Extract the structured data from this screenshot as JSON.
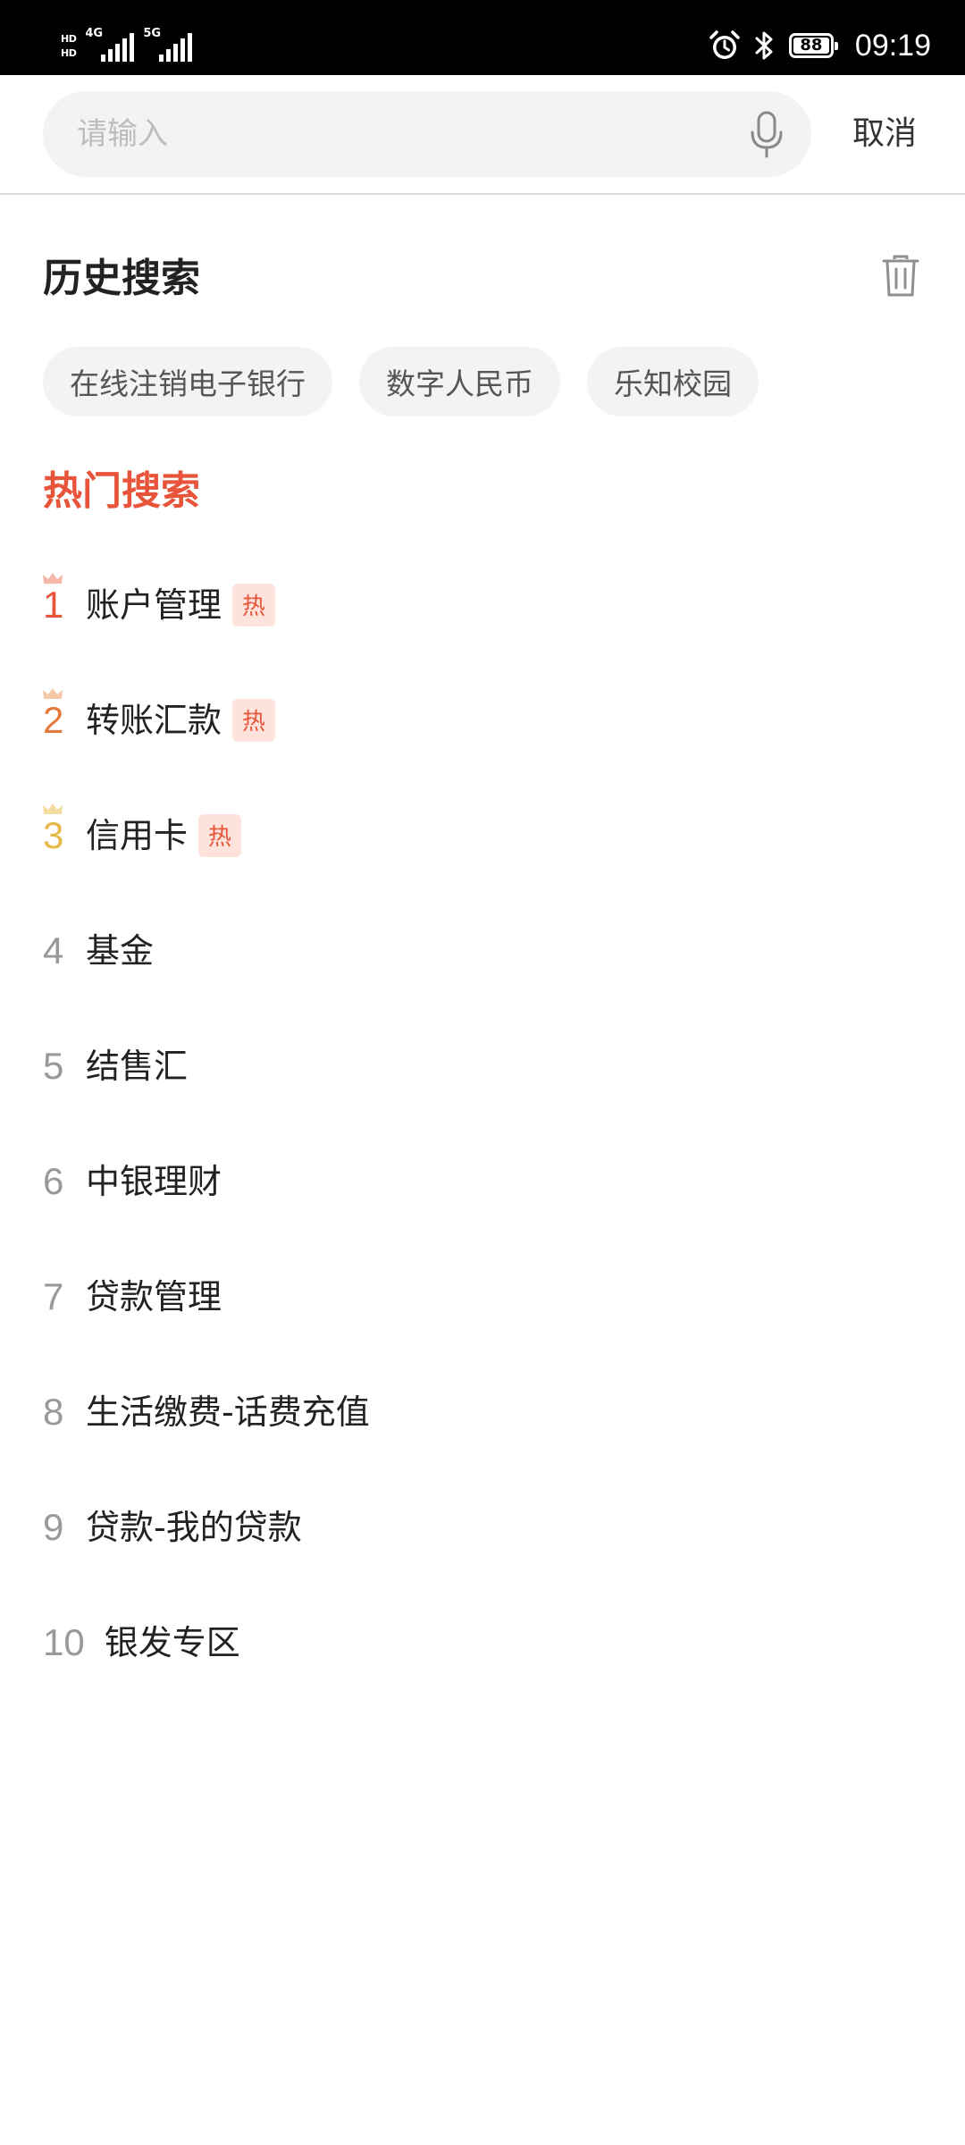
{
  "status_bar": {
    "hd_top": "HD",
    "hd_bottom": "HD",
    "network_1": "4G",
    "network_2": "5G",
    "battery": "88",
    "time": "09:19",
    "icons": [
      "alarm-icon",
      "bluetooth-icon"
    ]
  },
  "search": {
    "placeholder": "请输入",
    "value": "",
    "mic_icon": "microphone-icon",
    "cancel_label": "取消"
  },
  "history": {
    "title": "历史搜索",
    "delete_icon": "trash-icon",
    "items": [
      "在线注销电子银行",
      "数字人民币",
      "乐知校园"
    ]
  },
  "hot": {
    "title": "热门搜索",
    "badge_text": "热",
    "colors": {
      "title": "#e8543a",
      "rank_1": "#e8543a",
      "rank_2": "#e37a3a",
      "rank_3": "#e6b84a",
      "rank_default": "#999999",
      "badge_bg": "#fde3dc"
    },
    "items": [
      {
        "rank": "1",
        "label": "账户管理",
        "hot": true
      },
      {
        "rank": "2",
        "label": "转账汇款",
        "hot": true
      },
      {
        "rank": "3",
        "label": "信用卡",
        "hot": true
      },
      {
        "rank": "4",
        "label": "基金",
        "hot": false
      },
      {
        "rank": "5",
        "label": "结售汇",
        "hot": false
      },
      {
        "rank": "6",
        "label": "中银理财",
        "hot": false
      },
      {
        "rank": "7",
        "label": "贷款管理",
        "hot": false
      },
      {
        "rank": "8",
        "label": "生活缴费-话费充值",
        "hot": false
      },
      {
        "rank": "9",
        "label": "贷款-我的贷款",
        "hot": false
      },
      {
        "rank": "10",
        "label": "银发专区",
        "hot": false
      }
    ]
  }
}
